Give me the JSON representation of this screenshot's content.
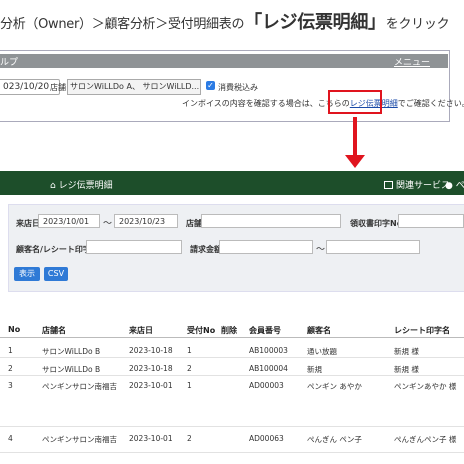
{
  "instruction": {
    "prefix": "分析（Owner）＞顧客分析＞受付明細表の",
    "highlight": "「レジ伝票明細」",
    "suffix": "をクリック"
  },
  "upper_panel": {
    "bar_left": "ルプ",
    "bar_right": "メニュー",
    "date_value": "023/10/20",
    "store_label": "店舗",
    "store_value": "サロンWiLLDo A、 サロンWiLLD...",
    "checkbox_label": "消費税込み",
    "info_prefix": "インボイスの内容を確認する場合は、こちらの",
    "info_link": "レジ伝票明細",
    "info_suffix": "でご確認ください。"
  },
  "navbar": {
    "home_label": "レジ伝票明細",
    "related_label": "関連サービス",
    "user_label": "ペ"
  },
  "filters": {
    "visit_date_label": "来店日",
    "date_from": "2023/10/01",
    "date_to": "2023/10/23",
    "range_sep": "〜",
    "store_label": "店舗",
    "receipt_label": "領収書印字No",
    "customer_label": "顧客名/レシート印字名",
    "amount_label": "請求金額",
    "amount_sep": "〜",
    "show_button": "表示",
    "csv_button": "CSV"
  },
  "table": {
    "headers": [
      "No",
      "店舗名",
      "来店日",
      "受付No",
      "削除",
      "会員番号",
      "顧客名",
      "レシート印字名"
    ],
    "rows": [
      [
        "1",
        "サロンWiLLDo B",
        "2023-10-18",
        "1",
        "",
        "AB100003",
        "通い放題",
        "新規 様"
      ],
      [
        "2",
        "サロンWiLLDo B",
        "2023-10-18",
        "2",
        "",
        "AB100004",
        "新規",
        "新規 様"
      ],
      [
        "3",
        "ペンギンサロン南福吉",
        "2023-10-01",
        "1",
        "",
        "AD00003",
        "ペンギン あやか",
        "ペンギンあやか 様"
      ],
      [
        "4",
        "ペンギンサロン南福吉",
        "2023-10-01",
        "2",
        "",
        "AD00063",
        "ぺんぎん ペン子",
        "ぺんぎんペン子 様"
      ]
    ]
  },
  "colors": {
    "navbar": "#1d4e2a",
    "accent_red": "#e0141e",
    "button_blue": "#2f7ad6"
  }
}
